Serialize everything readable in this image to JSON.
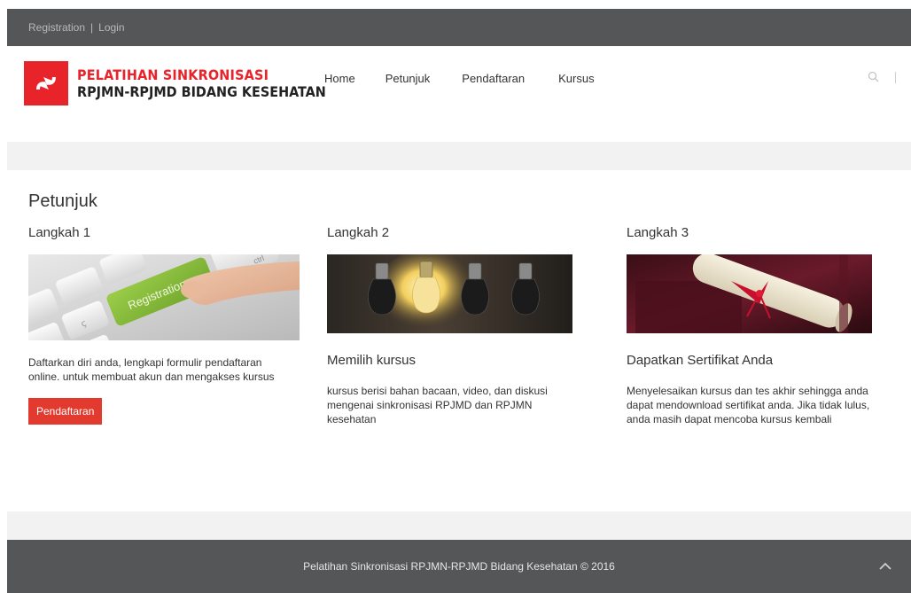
{
  "topbar": {
    "registration_link": "Registration",
    "separator": "|",
    "login_link": "Login"
  },
  "logo": {
    "line1": "PELATIHAN SINKRONISASI",
    "line2": "RPJMN-RPJMD BIDANG KESEHATAN",
    "brand_color": "#e8232a"
  },
  "nav": {
    "items": [
      {
        "label": "Home"
      },
      {
        "label": "Petunjuk"
      },
      {
        "label": "Pendaftaran"
      },
      {
        "label": "Kursus"
      }
    ]
  },
  "header_tools": {
    "search_icon": "search-icon",
    "more_icon": "more-vertical-icon"
  },
  "main": {
    "title": "Petunjuk",
    "steps": [
      {
        "label": "Langkah 1",
        "image": "keyboard-registration-key",
        "heading": "",
        "description": "Daftarkan diri anda, lengkapi formulir pendaftaran online. untuk membuat akun dan mengakses kursus",
        "button_label": "Pendaftaran"
      },
      {
        "label": "Langkah 2",
        "image": "light-bulbs",
        "heading": "Memilih kursus",
        "description": "kursus berisi bahan bacaan, video, dan diskusi mengenai sinkronisasi RPJMD dan RPJMN kesehatan"
      },
      {
        "label": "Langkah 3",
        "image": "diploma-scroll",
        "heading": "Dapatkan Sertifikat Anda",
        "description": "Menyelesaikan kursus dan tes akhir sehingga anda dapat mendownload sertifikat anda. Jika tidak lulus, anda masih dapat mencoba kursus kembali"
      }
    ]
  },
  "footer": {
    "text": "Pelatihan Sinkronisasi RPJMN-RPJMD Bidang Kesehatan © 2016",
    "scroll_top_icon": "chevron-up-icon"
  },
  "colors": {
    "topbar_bg": "#555657",
    "accent_red": "#e23a2e",
    "band_gray": "#f2f2f2"
  }
}
